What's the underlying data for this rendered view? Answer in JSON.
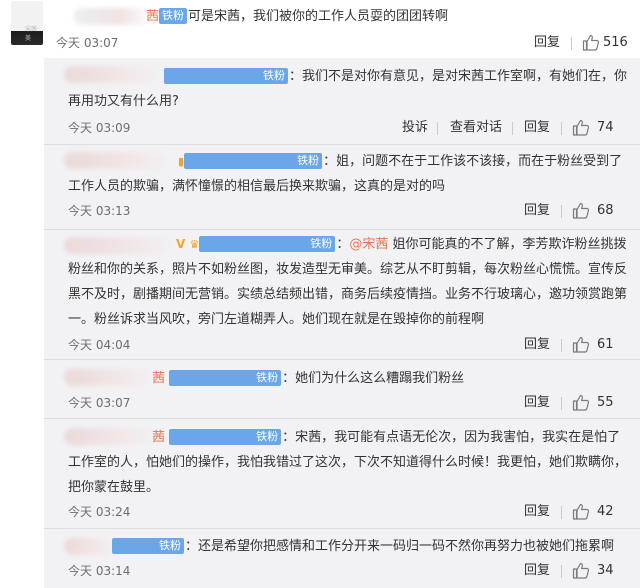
{
  "main_comment": {
    "text": "可是宋茜，我们被你的工作人员耍的团团转啊",
    "badge": "铁粉",
    "name_frag": "茜",
    "time": "今天 03:07",
    "reply_label": "回复",
    "likes": "516",
    "avatar_label": "宋茜·美"
  },
  "replies": [
    {
      "badge": "铁粉",
      "text": "：我们不是对你有意见，是对宋茜工作室啊，有她们在，你再用功又有什么用?",
      "time": "今天 03:09",
      "report_label": "投诉",
      "dialog_label": "查看对话",
      "reply_label": "回复",
      "likes": "74"
    },
    {
      "badge": "铁粉",
      "text": "：姐，问题不在于工作该不该接，而在于粉丝受到了工作人员的欺骗，满怀憧憬的相信最后换来欺骗，这真的是对的吗",
      "time": "今天 03:13",
      "reply_label": "回复",
      "likes": "68"
    },
    {
      "badge": "铁粉",
      "mention": "@宋茜",
      "text": " 姐你可能真的不了解，李芳欺诈粉丝挑拨粉丝和你的关系，照片不如粉丝图，妆发造型无审美。综艺从不盯剪辑，每次粉丝心慌慌。宣传反黑不及时，剧播期间无营销。实绩总结频出错，商务后续疫情挡。业务不行玻璃心，邀功领赏跑第一。粉丝诉求当风吹，旁门左道糊弄人。她们现在就是在毁掉你的前程啊",
      "time": "今天 04:04",
      "reply_label": "回复",
      "likes": "61"
    },
    {
      "badge": "铁粉",
      "name_frag": "茜",
      "text": "：她们为什么这么糟蹋我们粉丝",
      "time": "今天 03:07",
      "reply_label": "回复",
      "likes": "55"
    },
    {
      "badge": "铁粉",
      "name_frag": "茜",
      "text": "：宋茜，我可能有点语无伦次，因为我害怕，我实在是怕了工作室的人，怕她们的操作，我怕我错过了这次，下次不知道得什么时候！我更怕，她们欺瞒你，把你蒙在鼓里。",
      "time": "今天 03:24",
      "reply_label": "回复",
      "likes": "42"
    },
    {
      "badge": "铁粉",
      "text": "：还是希望你把感情和工作分开来一码归一码不然你再努力也被她们拖累啊",
      "time": "今天 03:14",
      "reply_label": "回复",
      "likes": "34"
    }
  ]
}
